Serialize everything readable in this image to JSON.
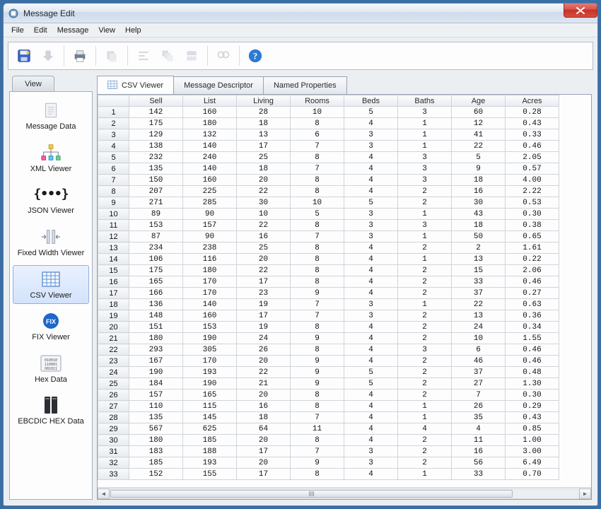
{
  "window": {
    "title": "Message Edit"
  },
  "menu": {
    "items": [
      "File",
      "Edit",
      "Message",
      "View",
      "Help"
    ]
  },
  "toolbar": {
    "buttons": [
      {
        "name": "save-icon",
        "enabled": true
      },
      {
        "name": "import-icon",
        "enabled": false
      },
      {
        "name": "print-icon",
        "enabled": true
      },
      {
        "name": "copy-icon",
        "enabled": false
      },
      {
        "name": "align-icon",
        "enabled": false
      },
      {
        "name": "cascade-icon",
        "enabled": false
      },
      {
        "name": "stack-icon",
        "enabled": false
      },
      {
        "name": "find-icon",
        "enabled": false
      },
      {
        "name": "help-icon",
        "enabled": true
      }
    ]
  },
  "sidebar": {
    "tab_label": "View",
    "items": [
      {
        "label": "Message Data",
        "icon": "document-icon"
      },
      {
        "label": "XML Viewer",
        "icon": "xml-tree-icon"
      },
      {
        "label": "JSON Viewer",
        "icon": "braces-icon"
      },
      {
        "label": "Fixed Width Viewer",
        "icon": "fixed-width-icon"
      },
      {
        "label": "CSV Viewer",
        "icon": "grid-icon",
        "selected": true
      },
      {
        "label": "FIX Viewer",
        "icon": "fix-badge-icon"
      },
      {
        "label": "Hex Data",
        "icon": "binary-icon"
      },
      {
        "label": "EBCDIC HEX Data",
        "icon": "server-icon"
      }
    ]
  },
  "main_tabs": [
    {
      "label": "CSV Viewer",
      "icon": "grid-icon",
      "active": true
    },
    {
      "label": "Message Descriptor",
      "active": false
    },
    {
      "label": "Named Properties",
      "active": false
    }
  ],
  "chart_data": {
    "type": "table",
    "columns": [
      "Sell",
      "List",
      "Living",
      "Rooms",
      "Beds",
      "Baths",
      "Age",
      "Acres"
    ],
    "rows": [
      [
        142,
        160,
        28,
        10,
        5,
        3,
        60,
        "0.28"
      ],
      [
        175,
        180,
        18,
        8,
        4,
        1,
        12,
        "0.43"
      ],
      [
        129,
        132,
        13,
        6,
        3,
        1,
        41,
        "0.33"
      ],
      [
        138,
        140,
        17,
        7,
        3,
        1,
        22,
        "0.46"
      ],
      [
        232,
        240,
        25,
        8,
        4,
        3,
        5,
        "2.05"
      ],
      [
        135,
        140,
        18,
        7,
        4,
        3,
        9,
        "0.57"
      ],
      [
        150,
        160,
        20,
        8,
        4,
        3,
        18,
        "4.00"
      ],
      [
        207,
        225,
        22,
        8,
        4,
        2,
        16,
        "2.22"
      ],
      [
        271,
        285,
        30,
        10,
        5,
        2,
        30,
        "0.53"
      ],
      [
        89,
        90,
        10,
        5,
        3,
        1,
        43,
        "0.30"
      ],
      [
        153,
        157,
        22,
        8,
        3,
        3,
        18,
        "0.38"
      ],
      [
        87,
        90,
        16,
        7,
        3,
        1,
        50,
        "0.65"
      ],
      [
        234,
        238,
        25,
        8,
        4,
        2,
        2,
        "1.61"
      ],
      [
        106,
        116,
        20,
        8,
        4,
        1,
        13,
        "0.22"
      ],
      [
        175,
        180,
        22,
        8,
        4,
        2,
        15,
        "2.06"
      ],
      [
        165,
        170,
        17,
        8,
        4,
        2,
        33,
        "0.46"
      ],
      [
        166,
        170,
        23,
        9,
        4,
        2,
        37,
        "0.27"
      ],
      [
        136,
        140,
        19,
        7,
        3,
        1,
        22,
        "0.63"
      ],
      [
        148,
        160,
        17,
        7,
        3,
        2,
        13,
        "0.36"
      ],
      [
        151,
        153,
        19,
        8,
        4,
        2,
        24,
        "0.34"
      ],
      [
        180,
        190,
        24,
        9,
        4,
        2,
        10,
        "1.55"
      ],
      [
        293,
        305,
        26,
        8,
        4,
        3,
        6,
        "0.46"
      ],
      [
        167,
        170,
        20,
        9,
        4,
        2,
        46,
        "0.46"
      ],
      [
        190,
        193,
        22,
        9,
        5,
        2,
        37,
        "0.48"
      ],
      [
        184,
        190,
        21,
        9,
        5,
        2,
        27,
        "1.30"
      ],
      [
        157,
        165,
        20,
        8,
        4,
        2,
        7,
        "0.30"
      ],
      [
        110,
        115,
        16,
        8,
        4,
        1,
        26,
        "0.29"
      ],
      [
        135,
        145,
        18,
        7,
        4,
        1,
        35,
        "0.43"
      ],
      [
        567,
        625,
        64,
        11,
        4,
        4,
        4,
        "0.85"
      ],
      [
        180,
        185,
        20,
        8,
        4,
        2,
        11,
        "1.00"
      ],
      [
        183,
        188,
        17,
        7,
        3,
        2,
        16,
        "3.00"
      ],
      [
        185,
        193,
        20,
        9,
        3,
        2,
        56,
        "6.49"
      ],
      [
        152,
        155,
        17,
        8,
        4,
        1,
        33,
        "0.70"
      ]
    ]
  }
}
